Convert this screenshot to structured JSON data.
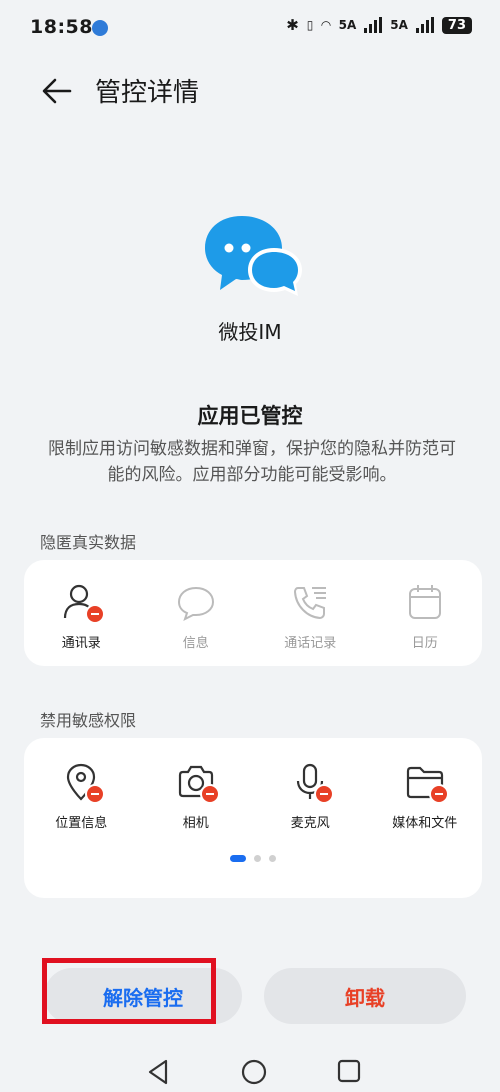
{
  "status_bar": {
    "time": "18:58",
    "battery": "73",
    "net1": "5A",
    "net2": "5A"
  },
  "header": {
    "title": "管控详情"
  },
  "app": {
    "name": "微投IM"
  },
  "status": {
    "title": "应用已管控",
    "description": "限制应用访问敏感数据和弹窗，保护您的隐私并防范可能的风险。应用部分功能可能受影响。"
  },
  "hidden_data": {
    "label": "隐匿真实数据",
    "items": [
      {
        "label": "通讯录",
        "icon": "contacts-icon",
        "active": true
      },
      {
        "label": "信息",
        "icon": "message-icon",
        "active": false
      },
      {
        "label": "通话记录",
        "icon": "call-log-icon",
        "active": false
      },
      {
        "label": "日历",
        "icon": "calendar-icon",
        "active": false
      }
    ]
  },
  "restricted": {
    "label": "禁用敏感权限",
    "items": [
      {
        "label": "位置信息",
        "icon": "location-icon"
      },
      {
        "label": "相机",
        "icon": "camera-icon"
      },
      {
        "label": "麦克风",
        "icon": "microphone-icon"
      },
      {
        "label": "媒体和文件",
        "icon": "folder-icon"
      }
    ],
    "page_count": 3,
    "current_page": 1
  },
  "actions": {
    "release": "解除管控",
    "uninstall": "卸载"
  },
  "colors": {
    "accent": "#1a6df0",
    "danger": "#e84026",
    "app_icon": "#1e9be8",
    "highlight": "#e01020"
  }
}
